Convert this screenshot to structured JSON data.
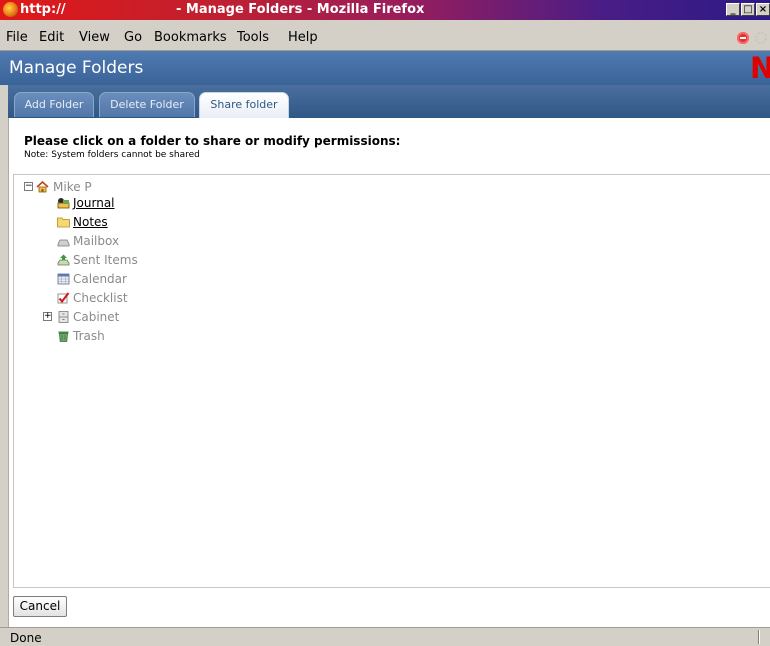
{
  "window": {
    "title_url": "http://",
    "title_rest": "- Manage Folders - Mozilla Firefox",
    "buttons": [
      "_",
      "□",
      "×"
    ]
  },
  "menu": {
    "items": [
      {
        "label": "File"
      },
      {
        "label": "Edit"
      },
      {
        "label": "View"
      },
      {
        "label": "Go"
      },
      {
        "label": "Bookmarks"
      },
      {
        "label": "Tools"
      },
      {
        "label": "Help"
      }
    ]
  },
  "header": {
    "title": "Manage Folders",
    "logo": "N"
  },
  "tabs": [
    {
      "label": "Add Folder",
      "active": false
    },
    {
      "label": "Delete Folder",
      "active": false
    },
    {
      "label": "Share folder",
      "active": true
    }
  ],
  "main": {
    "instruction": "Please click on a folder to share or modify permissions:",
    "note": "Note: System folders cannot be shared"
  },
  "tree": {
    "root": {
      "label": "Mike P",
      "expander": "−",
      "icon": "home-icon"
    },
    "items": [
      {
        "label": "Journal",
        "icon": "journal-icon",
        "shareable": true
      },
      {
        "label": "Notes",
        "icon": "folder-icon",
        "shareable": true
      },
      {
        "label": "Mailbox",
        "icon": "mailbox-icon",
        "shareable": false
      },
      {
        "label": "Sent Items",
        "icon": "sent-items-icon",
        "shareable": false
      },
      {
        "label": "Calendar",
        "icon": "calendar-icon",
        "shareable": false
      },
      {
        "label": "Checklist",
        "icon": "checklist-icon",
        "shareable": false
      },
      {
        "label": "Cabinet",
        "icon": "cabinet-icon",
        "shareable": false,
        "expander": "+"
      },
      {
        "label": "Trash",
        "icon": "trash-icon",
        "shareable": false
      }
    ]
  },
  "footer": {
    "cancel_label": "Cancel"
  },
  "status": {
    "text": "Done"
  },
  "colors": {
    "header_bg": "#3a6498",
    "logo": "#e00000",
    "chrome": "#d4d0c8"
  }
}
